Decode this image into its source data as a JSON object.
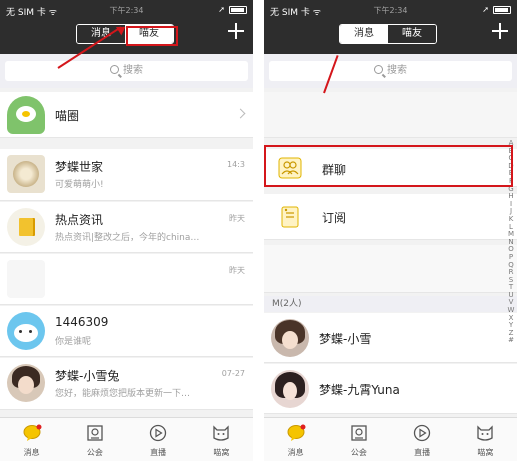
{
  "left": {
    "status": {
      "carrier": "无 SIM 卡 ᯤ",
      "time": "下午2:34",
      "location": "➚"
    },
    "segment": {
      "tab1": "消息",
      "tab2": "喵友",
      "active": "tab2"
    },
    "search": {
      "placeholder": "搜索"
    },
    "miaoquan": {
      "title": "喵圈"
    },
    "chats": [
      {
        "name": "梦蝶世家",
        "preview": "可爱萌萌小!",
        "time": "14:3"
      },
      {
        "name": "热点资讯",
        "preview": "热点资讯|整改之后，今年的china…",
        "time": "昨天"
      },
      {
        "name": "",
        "preview": "",
        "time": "昨天"
      },
      {
        "name": "1446309",
        "preview": "你是谁呢",
        "time": ""
      },
      {
        "name": "梦蝶-小雪兔",
        "preview": "您好，能麻烦您把版本更新一下…",
        "time": "07-27"
      }
    ]
  },
  "right": {
    "status": {
      "carrier": "无 SIM 卡 ᯤ",
      "time": "下午2:34",
      "location": "➚"
    },
    "segment": {
      "tab1": "消息",
      "tab2": "喵友",
      "active": "tab2"
    },
    "search": {
      "placeholder": "搜索"
    },
    "group_chat": "群聊",
    "subscribe": "订阅",
    "section": "M(2人)",
    "contacts": [
      {
        "name": "梦蝶-小雪"
      },
      {
        "name": "梦蝶-九霄Yuna"
      }
    ],
    "alphabet": [
      "A",
      "B",
      "C",
      "D",
      "E",
      "F",
      "G",
      "H",
      "I",
      "J",
      "K",
      "L",
      "M",
      "N",
      "O",
      "P",
      "Q",
      "R",
      "S",
      "T",
      "U",
      "V",
      "W",
      "X",
      "Y",
      "Z",
      "#"
    ]
  },
  "tabs": [
    {
      "label": "消息",
      "icon": "message-bubble-icon"
    },
    {
      "label": "公会",
      "icon": "guild-icon"
    },
    {
      "label": "直播",
      "icon": "play-circle-icon"
    },
    {
      "label": "喵窝",
      "icon": "cat-face-icon"
    }
  ],
  "colors": {
    "header": "#2d2d2d",
    "accent": "#f5c400",
    "highlight": "#d4161b"
  }
}
